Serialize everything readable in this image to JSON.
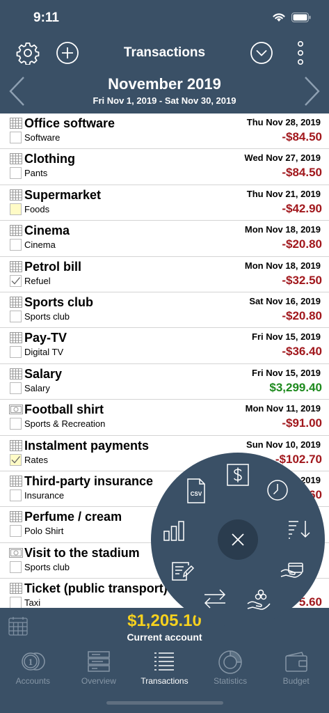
{
  "status_bar": {
    "time": "9:11"
  },
  "header": {
    "title": "Transactions",
    "month": "November 2019",
    "range": "Fri Nov 1, 2019 - Sat Nov 30, 2019"
  },
  "colors": {
    "header_bg": "#3a5066",
    "expense": "#a1171c",
    "income": "#1e8a1e",
    "balance": "#f6d11e"
  },
  "transactions": [
    {
      "title": "Office software",
      "category": "Software",
      "date": "Thu Nov 28, 2019",
      "amount": "-$84.50",
      "type": "expense",
      "icon": "calendar-icon",
      "marker": "none"
    },
    {
      "title": "Clothing",
      "category": "Pants",
      "date": "Wed Nov 27, 2019",
      "amount": "-$84.50",
      "type": "expense",
      "icon": "calendar-icon",
      "marker": "none"
    },
    {
      "title": "Supermarket",
      "category": "Foods",
      "date": "Thu Nov 21, 2019",
      "amount": "-$42.90",
      "type": "expense",
      "icon": "calendar-icon",
      "marker": "yellow"
    },
    {
      "title": "Cinema",
      "category": "Cinema",
      "date": "Mon Nov 18, 2019",
      "amount": "-$20.80",
      "type": "expense",
      "icon": "calendar-icon",
      "marker": "none"
    },
    {
      "title": "Petrol bill",
      "category": "Refuel",
      "date": "Mon Nov 18, 2019",
      "amount": "-$32.50",
      "type": "expense",
      "icon": "calendar-icon",
      "marker": "checked"
    },
    {
      "title": "Sports club",
      "category": "Sports club",
      "date": "Sat Nov 16, 2019",
      "amount": "-$20.80",
      "type": "expense",
      "icon": "calendar-icon",
      "marker": "none"
    },
    {
      "title": "Pay-TV",
      "category": "Digital TV",
      "date": "Fri Nov 15, 2019",
      "amount": "-$36.40",
      "type": "expense",
      "icon": "calendar-icon",
      "marker": "none"
    },
    {
      "title": "Salary",
      "category": "Salary",
      "date": "Fri Nov 15, 2019",
      "amount": "$3,299.40",
      "type": "income",
      "icon": "calendar-icon",
      "marker": "none"
    },
    {
      "title": "Football shirt",
      "category": "Sports & Recreation",
      "date": "Mon Nov 11, 2019",
      "amount": "-$91.00",
      "type": "expense",
      "icon": "cash-icon",
      "marker": "none"
    },
    {
      "title": "Instalment payments",
      "category": "Rates",
      "date": "Sun Nov 10, 2019",
      "amount": "-$102.70",
      "type": "expense",
      "icon": "calendar-icon",
      "marker": "yellow-checked"
    },
    {
      "title": "Third-party insurance",
      "category": "Insurance",
      "date": "2019",
      "amount": "60",
      "type": "expense",
      "icon": "calendar-icon",
      "marker": "none"
    },
    {
      "title": "Perfume / cream",
      "category": "Polo Shirt",
      "date": "",
      "amount": "",
      "type": "expense",
      "icon": "calendar-icon",
      "marker": "none"
    },
    {
      "title": "Visit to the stadium",
      "category": "Sports club",
      "date": "",
      "amount": "",
      "type": "expense",
      "icon": "cash-icon",
      "marker": "none"
    },
    {
      "title": "Ticket (public transport)",
      "category": "Taxi",
      "date": "",
      "amount": "5.60",
      "type": "expense",
      "icon": "calendar-icon",
      "marker": "none"
    }
  ],
  "footer": {
    "balance": "$1,205.10",
    "account": "Current account"
  },
  "tabs": [
    {
      "label": "Accounts",
      "icon": "coins-icon"
    },
    {
      "label": "Overview",
      "icon": "overview-icon"
    },
    {
      "label": "Transactions",
      "icon": "list-icon"
    },
    {
      "label": "Statistics",
      "icon": "pie-chart-icon"
    },
    {
      "label": "Budget",
      "icon": "wallet-icon"
    }
  ],
  "radial_menu": {
    "csv_label": "CSV",
    "items": [
      "csv-export-icon",
      "dollar-icon",
      "clock-icon",
      "sort-icon",
      "card-payment-icon",
      "income-hand-icon",
      "transfer-icon",
      "edit-note-icon",
      "bar-chart-icon"
    ]
  }
}
